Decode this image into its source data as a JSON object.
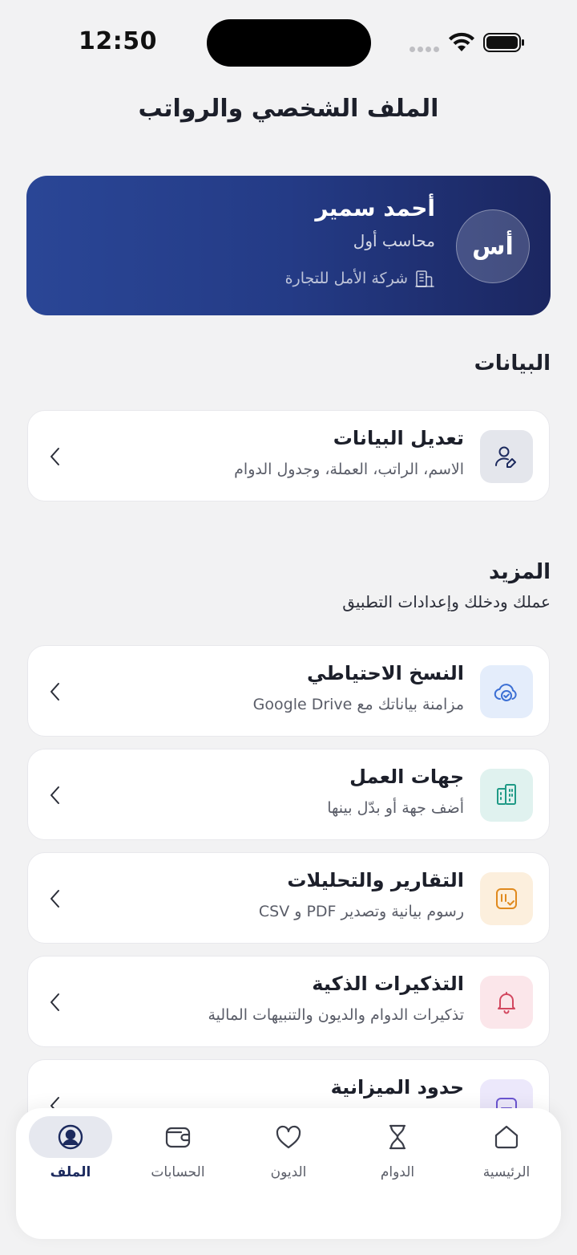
{
  "status_bar": {
    "time": "12:50"
  },
  "page": {
    "title": "الملف الشخصي والرواتب"
  },
  "profile": {
    "initials": "أس",
    "name": "أحمد سمير",
    "role": "محاسب أول",
    "company": "شركة الأمل للتجارة"
  },
  "sections": {
    "data": {
      "title": "البيانات"
    },
    "more": {
      "title": "المزيد",
      "subtitle": "عملك ودخلك وإعدادات التطبيق"
    }
  },
  "cards": {
    "edit": {
      "title": "تعديل البيانات",
      "subtitle": "الاسم، الراتب، العملة، وجدول الدوام"
    },
    "backup": {
      "title": "النسخ الاحتياطي",
      "subtitle": "مزامنة بياناتك مع Google Drive"
    },
    "employers": {
      "title": "جهات العمل",
      "subtitle": "أضف جهة أو بدّل بينها"
    },
    "reports": {
      "title": "التقارير والتحليلات",
      "subtitle": "رسوم بيانية وتصدير PDF و CSV"
    },
    "reminders": {
      "title": "التذكيرات الذكية",
      "subtitle": "تذكيرات الدوام والديون والتنبيهات المالية"
    },
    "budget": {
      "title": "حدود الميزانية"
    }
  },
  "nav": {
    "profile": "الملف",
    "accounts": "الحسابات",
    "debts": "الديون",
    "shifts": "الدوام",
    "home": "الرئيسية"
  },
  "colors": {
    "accent": "#1c2a5e",
    "card_gradient_start": "#2a4696",
    "card_gradient_end": "#1b2660"
  }
}
